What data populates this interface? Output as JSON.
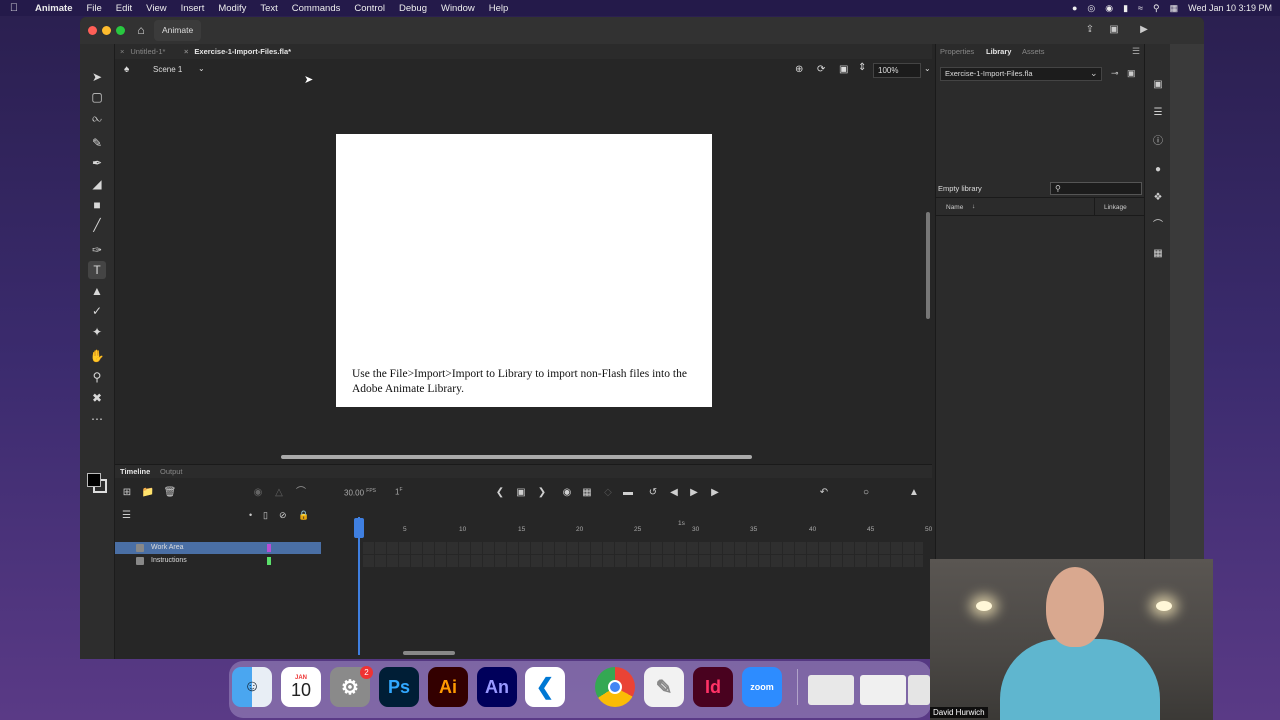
{
  "menubar": {
    "app_name": "Animate",
    "menus": [
      "File",
      "Edit",
      "View",
      "Insert",
      "Modify",
      "Text",
      "Commands",
      "Control",
      "Debug",
      "Window",
      "Help"
    ],
    "datetime": "Wed Jan 10  3:19 PM"
  },
  "window": {
    "app_tab": "Animate"
  },
  "doc_tabs": [
    {
      "label": "Untitled-1*"
    },
    {
      "label": "Exercise-1-Import-Files.fla*"
    }
  ],
  "scene": {
    "label": "Scene 1",
    "zoom": "100%"
  },
  "stage": {
    "text": "Use the File>Import>Import to Library to import non-Flash files into the Adobe Animate Library."
  },
  "timeline": {
    "tabs": [
      "Timeline",
      "Output"
    ],
    "fps": "30.00",
    "fps_unit": "FPS",
    "frame": "1",
    "frame_unit": "F",
    "ruler": [
      "5",
      "10",
      "15",
      "20",
      "25",
      "30",
      "35",
      "40",
      "45",
      "50"
    ],
    "seconds_marker": "1s",
    "layers": [
      {
        "name": "Work Area",
        "color": "#b84fd6",
        "selected": true
      },
      {
        "name": "Instructions",
        "color": "#5be06b",
        "selected": false
      }
    ]
  },
  "right_panel": {
    "tabs": [
      "Properties",
      "Library",
      "Assets"
    ],
    "library_file": "Exercise-1-Import-Files.fla",
    "empty_label": "Empty library",
    "col_name": "Name",
    "col_linkage": "Linkage"
  },
  "dock": {
    "calendar_month": "JAN",
    "calendar_day": "10",
    "badge_count": "2",
    "apps": [
      "Finder",
      "Calendar",
      "System Settings",
      "Photoshop",
      "Illustrator",
      "Animate",
      "VS Code",
      "Chrome",
      "Notes",
      "InDesign",
      "Zoom"
    ],
    "labels": {
      "ps": "Ps",
      "ai": "Ai",
      "an": "An",
      "id": "Id",
      "zoom": "zoom"
    }
  },
  "webcam": {
    "name": "David Hurwich"
  }
}
